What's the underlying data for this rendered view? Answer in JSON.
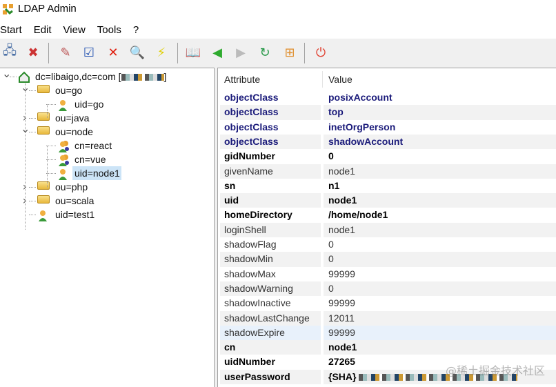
{
  "window": {
    "title": "LDAP Admin",
    "icon": "ldap-admin-logo"
  },
  "menu": [
    "Start",
    "Edit",
    "View",
    "Tools",
    "?"
  ],
  "toolbar": [
    {
      "name": "connect",
      "icon": "connect-icon",
      "glyph": "🖧",
      "color": "#4a6fa5"
    },
    {
      "name": "disconnect",
      "icon": "disconnect-icon",
      "glyph": "✖",
      "color": "#c33"
    },
    {
      "name": "edit-entry",
      "icon": "pencil-icon",
      "glyph": "✎",
      "color": "#b55"
    },
    {
      "name": "properties",
      "icon": "checklist-icon",
      "glyph": "☑",
      "color": "#2050b0"
    },
    {
      "name": "delete",
      "icon": "delete-x-icon",
      "glyph": "✕",
      "color": "#e02010"
    },
    {
      "name": "search",
      "icon": "search-icon",
      "glyph": "🔍",
      "color": "#3a7ad0"
    },
    {
      "name": "quick-search",
      "icon": "lightning-icon",
      "glyph": "⚡",
      "color": "#e0d000"
    },
    {
      "name": "schema",
      "icon": "book-icon",
      "glyph": "📖",
      "color": "#6a5acd"
    },
    {
      "name": "back",
      "icon": "arrow-left-icon",
      "glyph": "◀",
      "color": "#2eaa2e"
    },
    {
      "name": "forward",
      "icon": "arrow-right-icon",
      "glyph": "▶",
      "color": "#bbbbbb"
    },
    {
      "name": "refresh",
      "icon": "refresh-icon",
      "glyph": "↻",
      "color": "#2a9a4a"
    },
    {
      "name": "tree-view",
      "icon": "hierarchy-icon",
      "glyph": "⊞",
      "color": "#e09030"
    },
    {
      "name": "exit",
      "icon": "power-icon",
      "glyph": "⏻",
      "color": "#e04030"
    }
  ],
  "tree": [
    {
      "label": "dc=libaigo,dc=com [",
      "suffix": "]",
      "redacted": true,
      "level": 0,
      "expanded": true,
      "icon": "home-icon"
    },
    {
      "label": "ou=go",
      "level": 1,
      "expanded": true,
      "icon": "folder-icon"
    },
    {
      "label": "uid=go",
      "level": 2,
      "icon": "user-icon"
    },
    {
      "label": "ou=java",
      "level": 1,
      "expanded": false,
      "icon": "folder-icon"
    },
    {
      "label": "ou=node",
      "level": 1,
      "expanded": true,
      "icon": "folder-icon"
    },
    {
      "label": "cn=react",
      "level": 2,
      "icon": "group-icon"
    },
    {
      "label": "cn=vue",
      "level": 2,
      "icon": "group-icon"
    },
    {
      "label": "uid=node1",
      "level": 2,
      "icon": "user-icon",
      "selected": true
    },
    {
      "label": "ou=php",
      "level": 1,
      "expanded": false,
      "icon": "folder-icon"
    },
    {
      "label": "ou=scala",
      "level": 1,
      "expanded": false,
      "icon": "folder-icon"
    },
    {
      "label": "uid=test1",
      "level": 1,
      "icon": "user-icon"
    }
  ],
  "attributes": {
    "headers": [
      "Attribute",
      "Value"
    ],
    "rows": [
      {
        "attr": "objectClass",
        "value": "posixAccount",
        "style": "oc"
      },
      {
        "attr": "objectClass",
        "value": "top",
        "style": "oc"
      },
      {
        "attr": "objectClass",
        "value": "inetOrgPerson",
        "style": "oc"
      },
      {
        "attr": "objectClass",
        "value": "shadowAccount",
        "style": "oc"
      },
      {
        "attr": "gidNumber",
        "value": "0",
        "style": "bold"
      },
      {
        "attr": "givenName",
        "value": "node1",
        "style": "normal"
      },
      {
        "attr": "sn",
        "value": "n1",
        "style": "bold"
      },
      {
        "attr": "uid",
        "value": "node1",
        "style": "bold"
      },
      {
        "attr": "homeDirectory",
        "value": "/home/node1",
        "style": "bold"
      },
      {
        "attr": "loginShell",
        "value": "node1",
        "style": "normal"
      },
      {
        "attr": "shadowFlag",
        "value": "0",
        "style": "normal"
      },
      {
        "attr": "shadowMin",
        "value": "0",
        "style": "normal"
      },
      {
        "attr": "shadowMax",
        "value": "99999",
        "style": "normal"
      },
      {
        "attr": "shadowWarning",
        "value": "0",
        "style": "normal"
      },
      {
        "attr": "shadowInactive",
        "value": "99999",
        "style": "normal"
      },
      {
        "attr": "shadowLastChange",
        "value": "12011",
        "style": "normal"
      },
      {
        "attr": "shadowExpire",
        "value": "99999",
        "style": "normal",
        "highlighted": true
      },
      {
        "attr": "cn",
        "value": "node1",
        "style": "bold"
      },
      {
        "attr": "uidNumber",
        "value": "27265",
        "style": "bold"
      },
      {
        "attr": "userPassword",
        "value": "{SHA}",
        "style": "bold",
        "redacted": true
      }
    ]
  },
  "watermark": "@稀土掘金技术社区",
  "colors": {
    "objectclass_text": "#1a1a7a",
    "selection": "#cce4f7",
    "alt_row": "#f2f2f2"
  }
}
